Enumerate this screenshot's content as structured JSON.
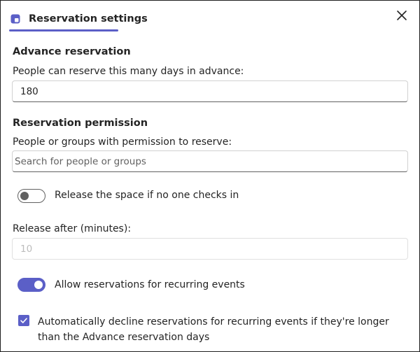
{
  "header": {
    "tab_label": "Reservation settings",
    "accent_color": "#5b5fc7"
  },
  "advance": {
    "title": "Advance reservation",
    "label": "People can reserve this many days in advance:",
    "value": "180"
  },
  "permission": {
    "title": "Reservation permission",
    "label": "People or groups with permission to reserve:",
    "placeholder": "Search for people or groups"
  },
  "release": {
    "toggle_label": "Release the space if no one checks in",
    "toggle_on": false,
    "after_label": "Release after (minutes):",
    "after_value": "10"
  },
  "recurring": {
    "toggle_label": "Allow reservations for recurring events",
    "toggle_on": true,
    "decline_label": "Automatically decline reservations for recurring events if they're longer than the Advance reservation days",
    "decline_checked": true
  },
  "icons": {
    "tab": "calendar-settings-icon",
    "close": "close-icon",
    "check": "checkmark-icon"
  }
}
